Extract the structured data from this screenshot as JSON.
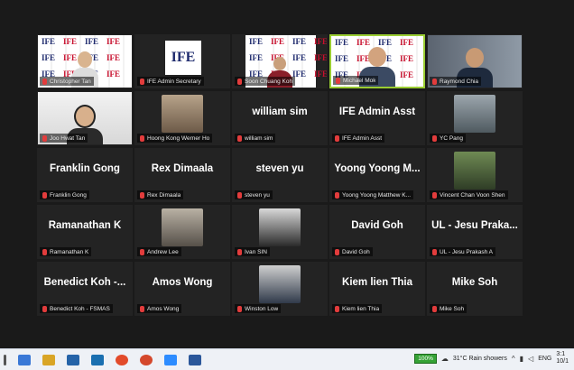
{
  "tiles": [
    {
      "caption": "Christopher Tan",
      "big": "",
      "kind": "video-ife",
      "active": false
    },
    {
      "caption": "IFE Admin Secretary",
      "big": "",
      "kind": "logo",
      "active": false
    },
    {
      "caption": "Soon Chuang Koh",
      "big": "",
      "kind": "video-ife",
      "active": false
    },
    {
      "caption": "Michael Mok",
      "big": "",
      "kind": "video-ife",
      "active": true
    },
    {
      "caption": "Raymond Chia",
      "big": "",
      "kind": "video-office",
      "active": false
    },
    {
      "caption": "Joo Hwat Tan",
      "big": "",
      "kind": "video-room",
      "active": false
    },
    {
      "caption": "Hoong Kong Werner Ho",
      "big": "",
      "kind": "photo",
      "active": false
    },
    {
      "caption": "william sim",
      "big": "william sim",
      "kind": "name",
      "active": false
    },
    {
      "caption": "IFE Admin Asst",
      "big": "IFE Admin Asst",
      "kind": "name",
      "active": false
    },
    {
      "caption": "YC Pang",
      "big": "",
      "kind": "photo",
      "active": false
    },
    {
      "caption": "Franklin Gong",
      "big": "Franklin Gong",
      "kind": "name",
      "active": false
    },
    {
      "caption": "Rex Dimaala",
      "big": "Rex Dimaala",
      "kind": "name",
      "active": false
    },
    {
      "caption": "steven yu",
      "big": "steven yu",
      "kind": "name",
      "active": false
    },
    {
      "caption": "Yoong Yoong Matthew K...",
      "big": "Yoong Yoong M...",
      "kind": "name",
      "active": false
    },
    {
      "caption": "Vincent Chan Voon Shen",
      "big": "",
      "kind": "photo",
      "active": false
    },
    {
      "caption": "Ramanathan K",
      "big": "Ramanathan K",
      "kind": "name",
      "active": false
    },
    {
      "caption": "Andrew Lee",
      "big": "",
      "kind": "photo",
      "active": false
    },
    {
      "caption": "Ivan SIN",
      "big": "",
      "kind": "photo",
      "active": false
    },
    {
      "caption": "David Goh",
      "big": "David Goh",
      "kind": "name",
      "active": false
    },
    {
      "caption": "UL - Jesu Prakash A",
      "big": "UL - Jesu Praka...",
      "kind": "name",
      "active": false
    },
    {
      "caption": "Benedict Koh - FSMAS",
      "big": "Benedict Koh -...",
      "kind": "name",
      "active": false
    },
    {
      "caption": "Amos Wong",
      "big": "Amos Wong",
      "kind": "name",
      "active": false
    },
    {
      "caption": "Winston Low",
      "big": "",
      "kind": "photo",
      "active": false
    },
    {
      "caption": "Kiem lien Thia",
      "big": "Kiem lien Thia",
      "kind": "name",
      "active": false
    },
    {
      "caption": "Mike Soh",
      "big": "Mike Soh",
      "kind": "name",
      "active": false
    }
  ],
  "logo_text": "IFE",
  "taskbar": {
    "battery": "100%",
    "weather": "31°C  Rain showers",
    "lang": "ENG",
    "time": "3:1",
    "date": "10/1"
  },
  "colors": {
    "window_bg": "#1a1a1a",
    "tile_bg": "#232323",
    "active_border": "#9acd32",
    "muted_mic": "#e23c3c",
    "taskbar_bg": "#eef1f6"
  }
}
